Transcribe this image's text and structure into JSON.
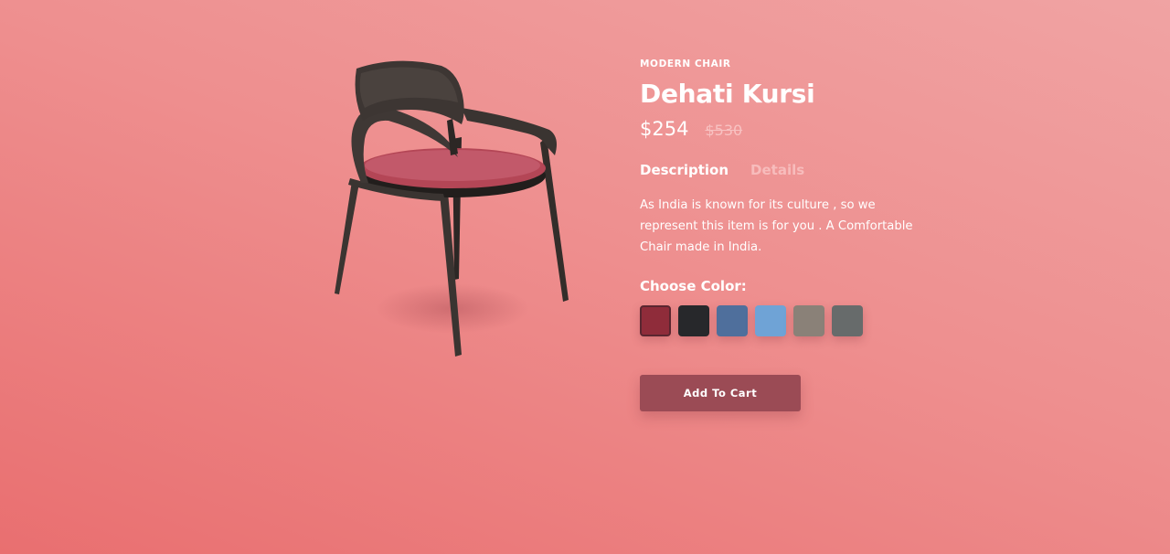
{
  "product": {
    "category": "MODERN CHAIR",
    "name": "Dehati Kursi",
    "price_current": "$254",
    "price_original": "$530"
  },
  "tabs": [
    {
      "label": "Description",
      "active": true
    },
    {
      "label": "Details",
      "active": false
    }
  ],
  "description": "As India is known for its culture , so we represent this item is for you . A Comfortable Chair made in India.",
  "color_picker": {
    "label": "Choose Color:",
    "selected_index": 0,
    "swatches": [
      {
        "name": "maroon",
        "color": "#8f2c3a"
      },
      {
        "name": "black",
        "color": "#27282b"
      },
      {
        "name": "denim",
        "color": "#4f6f9c"
      },
      {
        "name": "light-blue",
        "color": "#6fa3d6"
      },
      {
        "name": "taupe",
        "color": "#8a8178"
      },
      {
        "name": "charcoal",
        "color": "#676b6b"
      }
    ]
  },
  "cart": {
    "button_label": "Add To Cart"
  },
  "colors": {
    "background_top": "#f0a3a3",
    "background_bottom": "#e96f70",
    "button_bg": "#9b4b55",
    "chair_frame": "#3a3431",
    "chair_seat": "#b44656"
  }
}
